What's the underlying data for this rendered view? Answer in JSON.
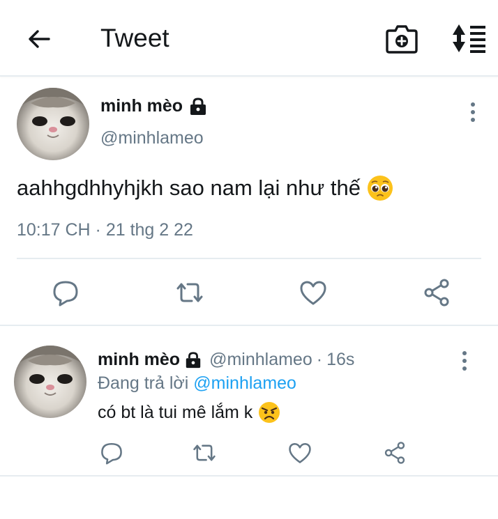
{
  "header": {
    "title": "Tweet",
    "back_icon": "arrow-left-icon",
    "camera_icon": "camera-plus-icon",
    "sort_icon": "sort-list-icon"
  },
  "main_tweet": {
    "author_name": "minh mèo",
    "handle": "@minhlameo",
    "text": "aahhgdhhyhjkh sao nam lại như thế",
    "emoji": "pleading-face",
    "meta": "10:17 CH · 21 thg 2 22",
    "protected_icon": "lock-icon",
    "actions": [
      "reply-icon",
      "retweet-icon",
      "like-icon",
      "share-icon"
    ]
  },
  "reply_tweet": {
    "author_name": "minh mèo",
    "handle": "@minhlameo",
    "separator": "·",
    "time": "16s",
    "replying_prefix": "Đang trả lời",
    "replying_to": "@minhlameo",
    "text": "có bt là tui mê lắm k",
    "emoji": "angry-face",
    "actions": [
      "reply-icon",
      "retweet-icon",
      "like-icon",
      "share-icon"
    ]
  },
  "colors": {
    "text": "#14171a",
    "secondary": "#657786",
    "accent": "#1da1f2",
    "divider": "#e6ecf0"
  }
}
